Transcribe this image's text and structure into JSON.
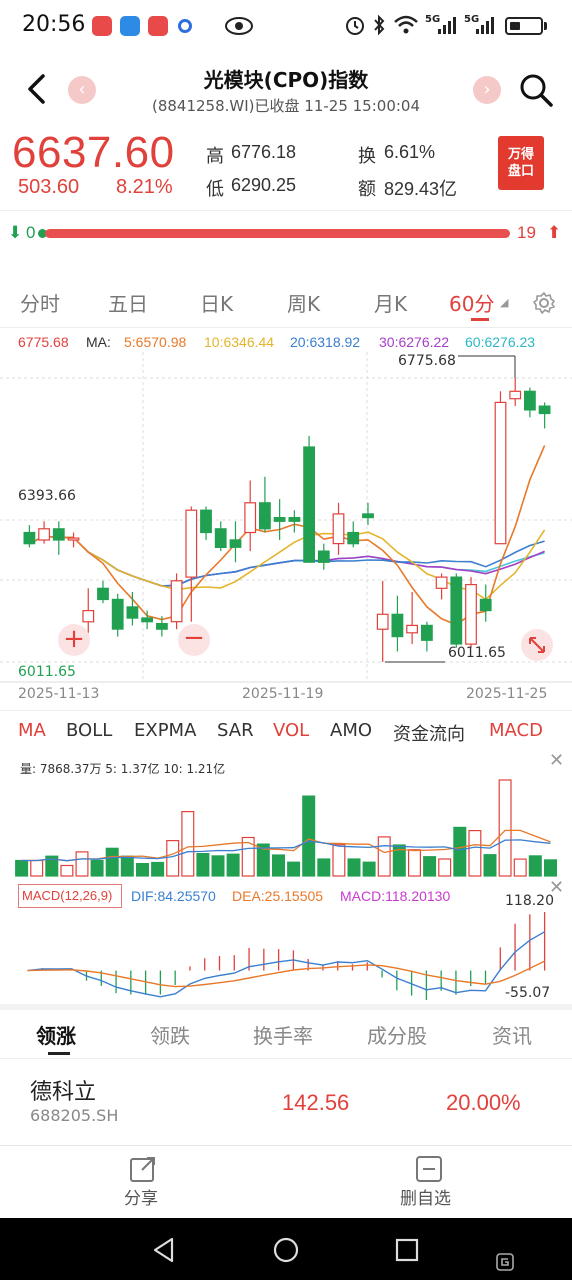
{
  "status": {
    "time": "20:56",
    "network": "5G",
    "network2": "5G"
  },
  "header": {
    "title": "光模块(CPO)指数",
    "subtitle": "(8841258.WI)已收盘 11-25 15:00:04"
  },
  "quote": {
    "price": "6637.60",
    "change": "503.60",
    "change_pct": "8.21%",
    "high_label": "高",
    "high": "6776.18",
    "low_label": "低",
    "low": "6290.25",
    "turnover_label": "换",
    "turnover": "6.61%",
    "amount_label": "额",
    "amount": "829.43亿",
    "wind_btn_line1": "万得",
    "wind_btn_line2": "盘口"
  },
  "breadth": {
    "down": "0",
    "up": "19"
  },
  "period_tabs": [
    "分时",
    "五日",
    "日K",
    "周K",
    "月K",
    "60分"
  ],
  "active_period": "60分",
  "ma_legend": {
    "top": "6775.68",
    "label": "MA:",
    "ma5": "5:6570.98",
    "ma10": "10:6346.44",
    "ma20": "20:6318.92",
    "ma30": "30:6276.22",
    "ma60": "60:6276.23"
  },
  "colors": {
    "up": "#e0413b",
    "down": "#22a052",
    "ma5": "#e8792a",
    "ma10": "#e4b52b",
    "ma20": "#3a7fd0",
    "ma30": "#a63fc8",
    "ma60": "#4ac7d6"
  },
  "chart_data": {
    "type": "candlestick",
    "title": "",
    "ylim": [
      6011.65,
      6775.68
    ],
    "price_labels": {
      "max": "6775.68",
      "mid": "6393.66",
      "min": "6011.65",
      "max_marker": "6775.68",
      "min_marker": "6011.65"
    },
    "x_ticks": [
      "2025-11-13",
      "2025-11-19",
      "2025-11-25"
    ],
    "candles": [
      {
        "o": 6360,
        "c": 6330,
        "h": 6380,
        "l": 6320
      },
      {
        "o": 6340,
        "c": 6370,
        "h": 6390,
        "l": 6330
      },
      {
        "o": 6370,
        "c": 6340,
        "h": 6390,
        "l": 6300
      },
      {
        "o": 6340,
        "c": 6345,
        "h": 6360,
        "l": 6320
      },
      {
        "o": 6120,
        "c": 6150,
        "h": 6210,
        "l": 6090
      },
      {
        "o": 6210,
        "c": 6180,
        "h": 6230,
        "l": 6170
      },
      {
        "o": 6180,
        "c": 6100,
        "h": 6195,
        "l": 6080
      },
      {
        "o": 6160,
        "c": 6130,
        "h": 6200,
        "l": 6110
      },
      {
        "o": 6130,
        "c": 6120,
        "h": 6150,
        "l": 6100
      },
      {
        "o": 6115,
        "c": 6100,
        "h": 6135,
        "l": 6080
      },
      {
        "o": 6120,
        "c": 6230,
        "h": 6250,
        "l": 6100
      },
      {
        "o": 6240,
        "c": 6420,
        "h": 6430,
        "l": 6120
      },
      {
        "o": 6420,
        "c": 6360,
        "h": 6430,
        "l": 6340
      },
      {
        "o": 6370,
        "c": 6320,
        "h": 6390,
        "l": 6310
      },
      {
        "o": 6340,
        "c": 6320,
        "h": 6390,
        "l": 6280
      },
      {
        "o": 6360,
        "c": 6440,
        "h": 6500,
        "l": 6310
      },
      {
        "o": 6440,
        "c": 6370,
        "h": 6510,
        "l": 6360
      },
      {
        "o": 6400,
        "c": 6390,
        "h": 6450,
        "l": 6340
      },
      {
        "o": 6400,
        "c": 6390,
        "h": 6420,
        "l": 6360
      },
      {
        "o": 6590,
        "c": 6280,
        "h": 6620,
        "l": 6280
      },
      {
        "o": 6310,
        "c": 6280,
        "h": 6330,
        "l": 6260
      },
      {
        "o": 6330,
        "c": 6410,
        "h": 6440,
        "l": 6300
      },
      {
        "o": 6360,
        "c": 6330,
        "h": 6390,
        "l": 6320
      },
      {
        "o": 6410,
        "c": 6400,
        "h": 6440,
        "l": 6380
      },
      {
        "o": 6100,
        "c": 6140,
        "h": 6230,
        "l": 6011.65
      },
      {
        "o": 6140,
        "c": 6080,
        "h": 6190,
        "l": 6040
      },
      {
        "o": 6090,
        "c": 6110,
        "h": 6200,
        "l": 6060
      },
      {
        "o": 6110,
        "c": 6070,
        "h": 6120,
        "l": 6040
      },
      {
        "o": 6210,
        "c": 6240,
        "h": 6250,
        "l": 6180
      },
      {
        "o": 6240,
        "c": 6060,
        "h": 6250,
        "l": 6050
      },
      {
        "o": 6060,
        "c": 6220,
        "h": 6240,
        "l": 6050
      },
      {
        "o": 6180,
        "c": 6150,
        "h": 6220,
        "l": 6120
      },
      {
        "o": 6330,
        "c": 6710,
        "h": 6740,
        "l": 6330
      },
      {
        "o": 6720,
        "c": 6740,
        "h": 6775.68,
        "l": 6700
      },
      {
        "o": 6740,
        "c": 6690,
        "h": 6750,
        "l": 6670
      },
      {
        "o": 6700,
        "c": 6680,
        "h": 6710,
        "l": 6640
      }
    ]
  },
  "indicator_tabs": [
    "MA",
    "BOLL",
    "EXPMA",
    "SAR",
    "VOL",
    "AMO",
    "资金流向",
    "MACD"
  ],
  "active_indicators": [
    "MA",
    "VOL",
    "MACD"
  ],
  "volume": {
    "info": "量:  7868.37万  5:  1.37亿  10:  1.21亿"
  },
  "macd": {
    "label": "MACD(12,26,9)",
    "dif": "DIF:84.25570",
    "dea": "DEA:25.15505",
    "macd": "MACD:118.20130",
    "max": "118.20",
    "min": "-55.07"
  },
  "bottom_tabs": [
    "领涨",
    "领跌",
    "换手率",
    "成分股",
    "资讯"
  ],
  "stock_row": {
    "name": "德科立",
    "code": "688205.SH",
    "price": "142.56",
    "pct": "20.00%"
  },
  "actions": {
    "share": "分享",
    "remove": "删自选"
  }
}
